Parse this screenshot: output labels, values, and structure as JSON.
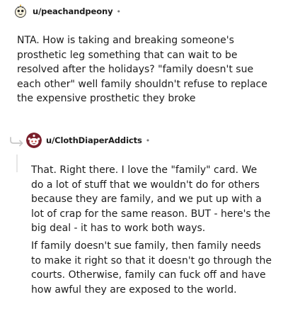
{
  "comments": [
    {
      "username": "u/peachandpeony",
      "separator": "•",
      "avatar_icon": "cartoon-snoo-avatar-icon",
      "paragraphs": [
        "NTA. How is taking and breaking someone's prosthetic leg something that can wait to be resolved after the holidays? \"family doesn't sue each other\" well family shouldn't refuse to replace the expensive prosthetic they broke"
      ]
    },
    {
      "username": "u/ClothDiaperAddicts",
      "separator": "•",
      "avatar_icon": "snoo-avatar-icon",
      "reply_icon": "reply-arrow-icon",
      "paragraphs": [
        "That. Right there. I love the \"family\" card. We do a lot of stuff that we wouldn't do for others because they are family, and we put up with a lot of crap for the same reason. BUT - here's the big deal - it has to work both ways.",
        "If family doesn't sue family, then family needs to make it right so that it doesn't go through the courts. Otherwise, family can fuck off and have how awful they are exposed to the world."
      ]
    }
  ],
  "colors": {
    "text": "#1c1c1c",
    "meta": "#7c7c7c",
    "thread_line": "#e6e6e6",
    "avatar2_bg": "#7a1f2b"
  }
}
